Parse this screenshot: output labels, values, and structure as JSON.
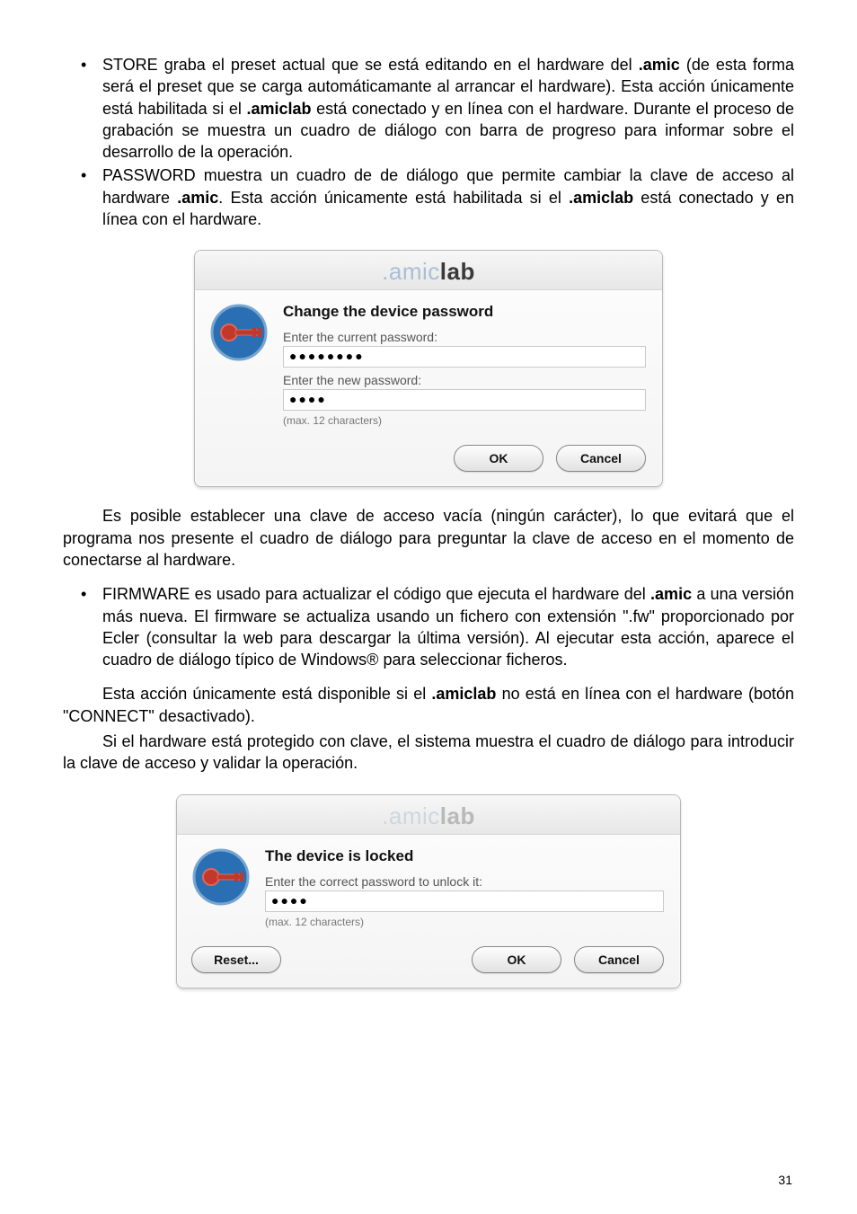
{
  "text": {
    "li1_a": "STORE graba el preset actual que se está editando en el hardware del ",
    "li1_b": ".amic",
    "li1_c": " (de esta forma será el preset que se carga automáticamante al arrancar el hardware). Esta acción únicamente está habilitada si el ",
    "li1_d": ".amiclab",
    "li1_e": " está conectado y en línea con el hardware. Durante el proceso de grabación se muestra un cuadro de diálogo con barra de progreso para informar sobre el desarrollo de la operación.",
    "li2_a": "PASSWORD muestra un cuadro de de diálogo que permite cambiar la clave de acceso al hardware ",
    "li2_b": ".amic",
    "li2_c": ". Esta acción únicamente está habilitada si el ",
    "li2_d": ".amiclab",
    "li2_e": " está conectado y en línea con el hardware.",
    "p1": "Es posible establecer una clave de acceso vacía (ningún carácter), lo que evitará que el programa nos presente el cuadro de diálogo para preguntar la clave de acceso en el momento de conectarse al hardware.",
    "li3_a": "FIRMWARE es usado para actualizar el código que ejecuta el hardware del ",
    "li3_b": ".amic",
    "li3_c": " a una versión más nueva. El firmware se actualiza usando un fichero con extensión \".fw\" proporcionado por Ecler (consultar la web para descargar la última versión). Al ejecutar esta acción, aparece el cuadro de diálogo típico de Windows® para seleccionar ficheros.",
    "p2_a": "Esta acción únicamente está disponible si el ",
    "p2_b": ".amiclab",
    "p2_c": " no está en línea con el hardware (botón \"CONNECT\" desactivado).",
    "p3": "Si el hardware está protegido con clave, el sistema muestra el cuadro de diálogo para introducir la clave de acceso y validar la operación."
  },
  "dialog1": {
    "logo_amic": ".amic",
    "logo_lab": "lab",
    "heading": "Change the device password",
    "label_current": "Enter the current password:",
    "value_current": "●●●●●●●●",
    "label_new": "Enter the new password:",
    "value_new": "●●●●",
    "hint": "(max. 12 characters)",
    "ok": "OK",
    "cancel": "Cancel"
  },
  "dialog2": {
    "logo_amic": ".amic",
    "logo_lab": "lab",
    "heading": "The device is locked",
    "label_pwd": "Enter the correct password to unlock it:",
    "value_pwd": "●●●●",
    "hint": "(max. 12 characters)",
    "reset": "Reset...",
    "ok": "OK",
    "cancel": "Cancel"
  },
  "page_number": "31"
}
